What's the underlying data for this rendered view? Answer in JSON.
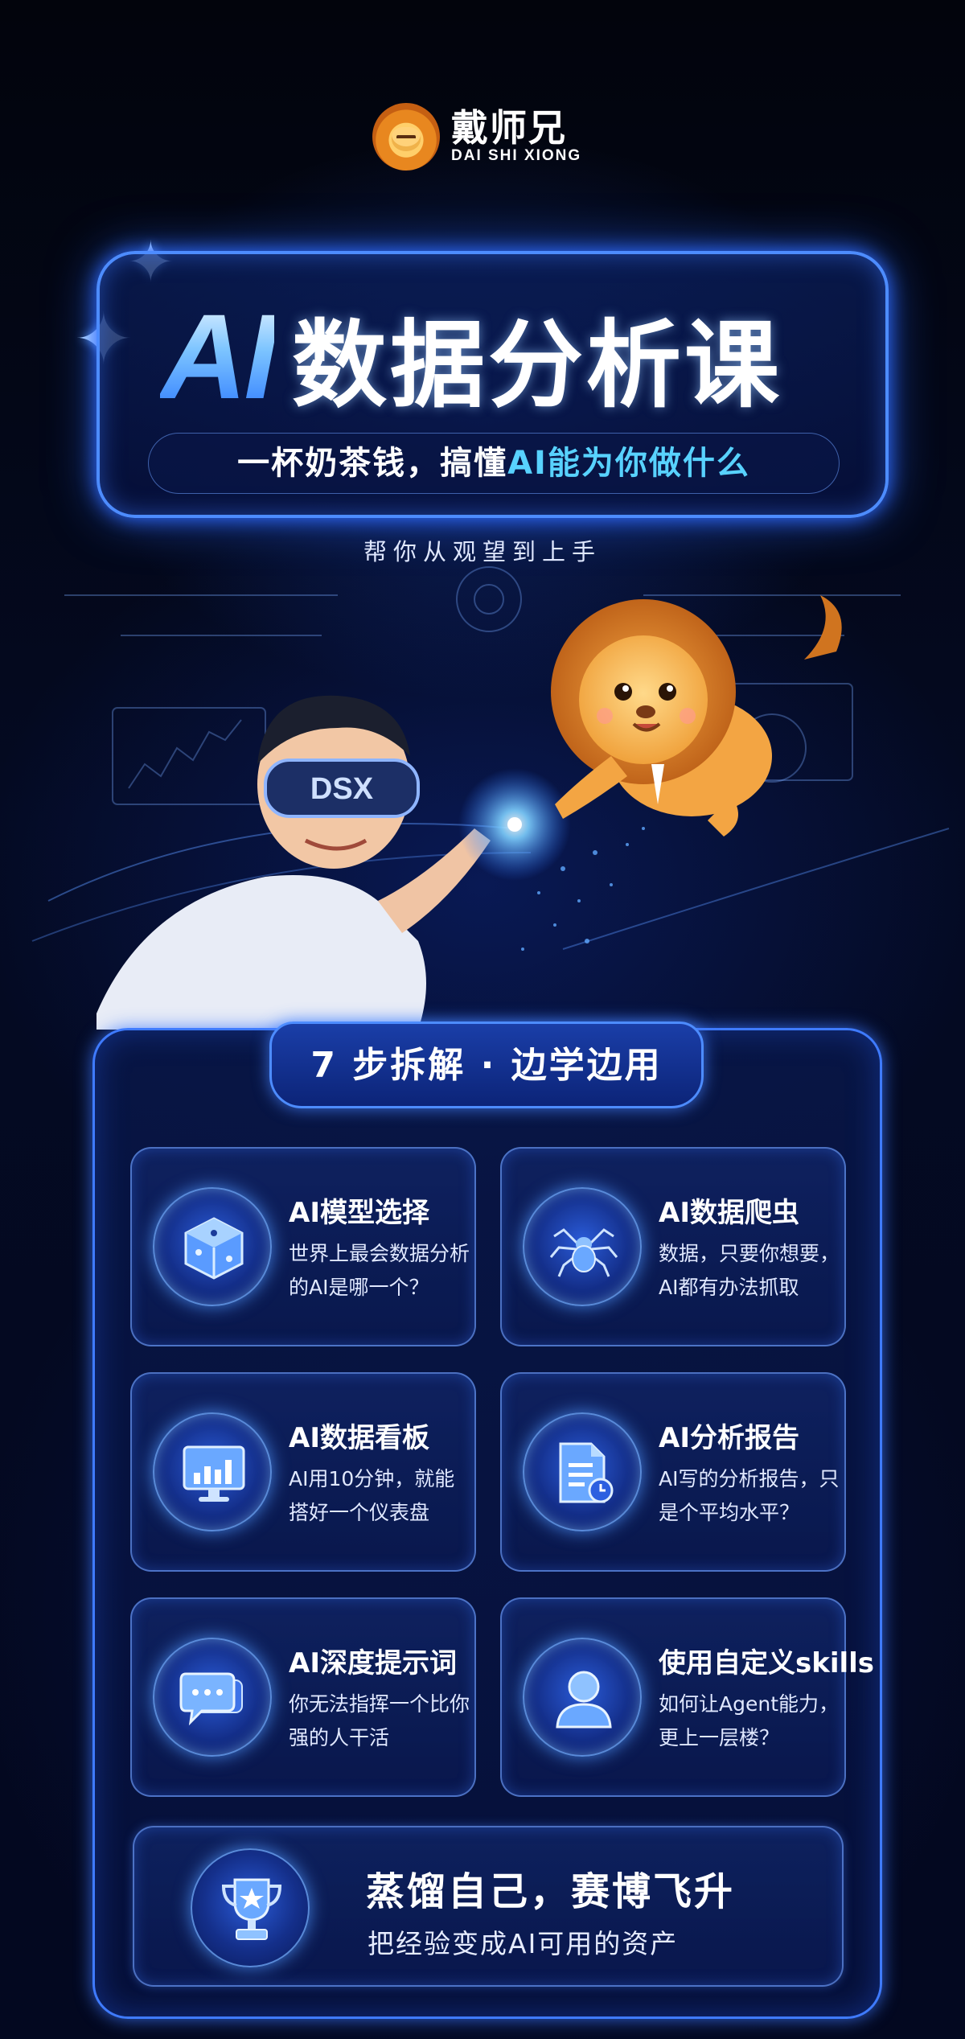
{
  "brand": {
    "name_cn": "戴师兄",
    "name_en": "DAI SHI XIONG"
  },
  "hero": {
    "title_ai": "AI",
    "title_cn": "数据分析课",
    "subtitle_pre": "一杯奶茶钱，搞懂",
    "subtitle_hl": "AI能为你做什么"
  },
  "tagline": "帮你从观望到上手",
  "illustration": {
    "visor_text": "DSX"
  },
  "section": {
    "tab": "7 步拆解 · 边学边用",
    "cards": [
      {
        "title": "AI模型选择",
        "desc": "世界上最会数据分析的AI是哪一个？",
        "icon": "cube-icon"
      },
      {
        "title": "AI数据爬虫",
        "desc": "数据，只要你想要，AI都有办法抓取",
        "icon": "spider-icon"
      },
      {
        "title": "AI数据看板",
        "desc": "AI用10分钟，就能搭好一个仪表盘",
        "icon": "dashboard-monitor-icon"
      },
      {
        "title": "AI分析报告",
        "desc": "AI写的分析报告，只是个平均水平？",
        "icon": "report-document-icon"
      },
      {
        "title": "AI深度提示词",
        "desc": "你无法指挥一个比你强的人干活",
        "icon": "chat-bubbles-icon"
      },
      {
        "title": "使用自定义skills",
        "desc": "如何让Agent能力，更上一层楼？",
        "icon": "user-profile-icon"
      }
    ],
    "final": {
      "title": "蒸馏自己，赛博飞升",
      "desc": "把经验变成AI可用的资产",
      "icon": "trophy-icon"
    }
  },
  "colors": {
    "accent": "#4d8cff",
    "highlight": "#58d2ff",
    "bg": "#02040c"
  }
}
